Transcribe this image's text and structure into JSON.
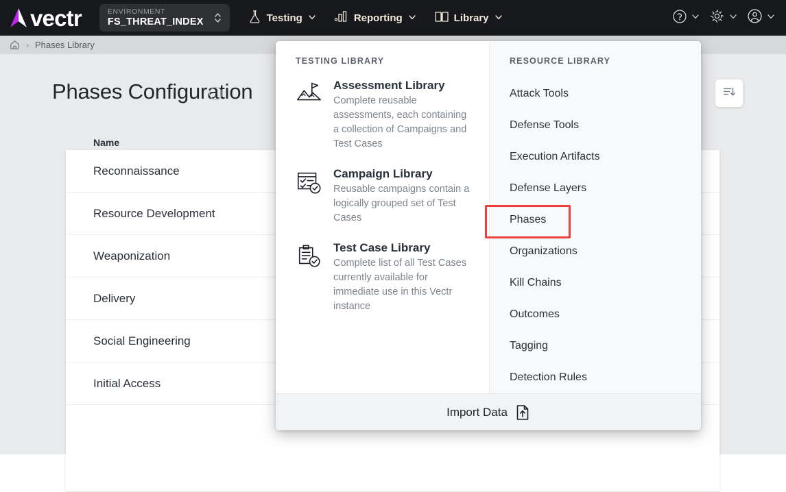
{
  "topnav": {
    "brand": "vectr",
    "brand_accent": "#c026f0",
    "environment_label": "ENVIRONMENT",
    "environment_value": "FS_THREAT_INDEX",
    "items": [
      {
        "label": "Testing",
        "icon": "flask-icon"
      },
      {
        "label": "Reporting",
        "icon": "bar-chart-icon"
      },
      {
        "label": "Library",
        "icon": "book-icon"
      }
    ],
    "right_icons": [
      {
        "name": "help-icon"
      },
      {
        "name": "gear-icon"
      },
      {
        "name": "account-icon"
      }
    ],
    "background": "#17181c",
    "item_color": "#f3e9dd"
  },
  "breadcrumb": {
    "home_icon": "home-icon",
    "separator": "›",
    "current": "Phases Library"
  },
  "page": {
    "title": "Phases Configuration",
    "info_icon": "info-circle-icon",
    "sort_icon": "sort-descending-icon"
  },
  "table": {
    "columns": [
      "Name"
    ],
    "rows": [
      "Reconnaissance",
      "Resource Development",
      "Weaponization",
      "Delivery",
      "Social Engineering",
      "Initial Access"
    ]
  },
  "menu": {
    "testing_library": {
      "heading": "TESTING LIBRARY",
      "items": [
        {
          "icon": "mountain-flag-icon",
          "title": "Assessment Library",
          "desc": "Complete reusable assessments, each containing a collection of Campaigns and Test Cases"
        },
        {
          "icon": "checklist-icon",
          "title": "Campaign Library",
          "desc": "Reusable campaigns contain a logically grouped set of Test Cases"
        },
        {
          "icon": "clipboard-check-icon",
          "title": "Test Case Library",
          "desc": "Complete list of all Test Cases currently available for immediate use in this Vectr instance"
        }
      ]
    },
    "resource_library": {
      "heading": "RESOURCE LIBRARY",
      "items": [
        {
          "label": "Attack Tools",
          "highlighted": false
        },
        {
          "label": "Defense Tools",
          "highlighted": false
        },
        {
          "label": "Execution Artifacts",
          "highlighted": false
        },
        {
          "label": "Defense Layers",
          "highlighted": false
        },
        {
          "label": "Phases",
          "highlighted": true
        },
        {
          "label": "Organizations",
          "highlighted": false
        },
        {
          "label": "Kill Chains",
          "highlighted": false
        },
        {
          "label": "Outcomes",
          "highlighted": false
        },
        {
          "label": "Tagging",
          "highlighted": false
        },
        {
          "label": "Detection Rules",
          "highlighted": false
        }
      ],
      "highlight_color": "#f03d3d"
    },
    "footer": {
      "label": "Import Data",
      "icon": "file-upload-icon"
    }
  }
}
